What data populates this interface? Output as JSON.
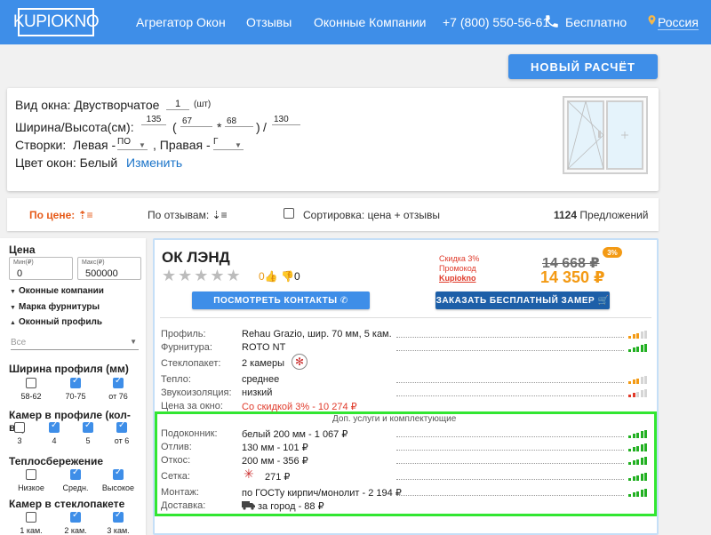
{
  "header": {
    "logo": "KUPIOKNO",
    "nav": [
      "Агрегатор Окон",
      "Отзывы",
      "Оконные Компании"
    ],
    "phone": "+7 (800) 550-56-61",
    "phone_note": "Бесплатно",
    "country": "Россия",
    "colors": {
      "bar": "#3e8ee8",
      "text": "#ffffff"
    }
  },
  "new_calc_label": "НОВЫЙ РАСЧЁТ",
  "params": {
    "window_type_label": "Вид окна: Двустворчатое",
    "qty_value": "1",
    "qty_unit": "(шт)",
    "size_label": "Ширина/Высота(см):",
    "size_width": "135",
    "size_open": "(",
    "size_part1": "67",
    "size_times": "*",
    "size_part2": "68",
    "size_close": ")",
    "size_slash": "/",
    "size_height": "130",
    "sash_label": "Створки:",
    "sash_left_label": "Левая -",
    "sash_left_value": "ПО",
    "sash_right_label": ", Правая -",
    "sash_right_value": "Г",
    "color_label": "Цвет окон: Белый",
    "change_link": "Изменить"
  },
  "sortbar": {
    "by_price": "По цене:",
    "by_reviews": "По отзывам:",
    "sort_combo": "Сортировка: цена + отзывы",
    "sort_combo_checked": false,
    "count": "1124",
    "count_label": "Предложений"
  },
  "sidebar": {
    "price_title": "Цена",
    "min_label": "Мин(₽)",
    "min_value": "0",
    "max_label": "Макс(₽)",
    "max_value": "500000",
    "acc_companies": "Оконные компании",
    "acc_hardware": "Марка фурнитуры",
    "acc_profile": "Оконный профиль",
    "all_placeholder": "Все",
    "profile_width_title": "Ширина профиля (мм)",
    "profile_width_options": [
      {
        "label": "58-62",
        "checked": false
      },
      {
        "label": "70-75",
        "checked": true
      },
      {
        "label": "от 76",
        "checked": true
      }
    ],
    "chambers_title": "Камер в профиле (кол-во)",
    "chambers_options": [
      {
        "label": "3",
        "checked": false
      },
      {
        "label": "4",
        "checked": true
      },
      {
        "label": "5",
        "checked": true
      },
      {
        "label": "от 6",
        "checked": true
      }
    ],
    "heat_title": "Теплосбережение",
    "heat_options": [
      {
        "label": "Низкое",
        "checked": false
      },
      {
        "label": "Средн.",
        "checked": true
      },
      {
        "label": "Высокое",
        "checked": true
      }
    ],
    "glass_title": "Камер в стеклопакете",
    "glass_options": [
      {
        "label": "1 кам.",
        "checked": false
      },
      {
        "label": "2 кам.",
        "checked": true
      },
      {
        "label": "3 кам.",
        "checked": true
      }
    ]
  },
  "offer": {
    "company": "ОК ЛЭНД",
    "stars": "★★★★★",
    "rating": 0,
    "likes": "0",
    "dislikes": "0",
    "discount_line1": "Скидка 3%",
    "discount_line2": "Промокод",
    "promo_code": "Kupiokno",
    "old_price": "14 668 ₽",
    "new_price": "14 350 ₽",
    "badge": "3%",
    "contacts_btn": "ПОСМОТРЕТЬ КОНТАКТЫ",
    "measure_btn": "ЗАКАЗАТЬ БЕСПЛАТНЫЙ ЗАМЕР",
    "specs": [
      {
        "label": "Профиль:",
        "value": "Rehau Grazio, шир. 70 мм, 5 кам.",
        "bars": 5,
        "active": 3,
        "color": "#f39a14"
      },
      {
        "label": "Фурнитура:",
        "value": "ROTO NT",
        "bars": 5,
        "active": 5,
        "color": "#22b022"
      },
      {
        "label": "Стеклопакет:",
        "value": "2 камеры",
        "bars": 0
      },
      {
        "label": "Тепло:",
        "value": "среднее",
        "bars": 5,
        "active": 3,
        "color": "#f39a14"
      },
      {
        "label": "Звукоизоляция:",
        "value": "низкий",
        "bars": 5,
        "active": 2,
        "color": "#e03a2a"
      },
      {
        "label": "Цена за окно:",
        "value": "Со скидкой 3% - 10 274 ₽",
        "bars": 0,
        "red": true
      }
    ],
    "extras_title": "Доп. услуги и комплектующие",
    "extras": [
      {
        "label": "Подоконник:",
        "value": "белый 200 мм - 1 067 ₽",
        "bars": 5,
        "active": 5
      },
      {
        "label": "Отлив:",
        "value": "130 мм - 101 ₽",
        "bars": 5,
        "active": 5
      },
      {
        "label": "Откос:",
        "value": "200 мм - 356 ₽",
        "bars": 5,
        "active": 5
      },
      {
        "label": "Сетка:",
        "value": "271 ₽",
        "bars": 5,
        "active": 5
      },
      {
        "label": "Монтаж:",
        "value": "по ГОСТу кирпич/монолит - 2 194 ₽",
        "bars": 5,
        "active": 5
      },
      {
        "label": "Доставка:",
        "value": "за город - 88 ₽",
        "bars": 0
      }
    ]
  }
}
